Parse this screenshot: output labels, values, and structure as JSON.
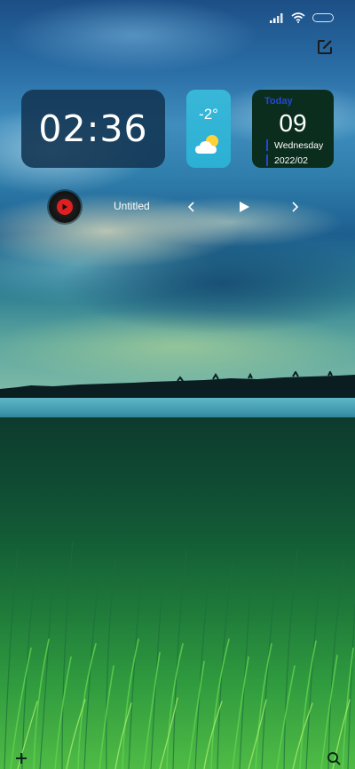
{
  "clock": {
    "time": "02:36"
  },
  "weather": {
    "temperature": "-2°",
    "icon": "partly-cloudy-icon"
  },
  "calendar": {
    "label": "Today",
    "day": "09",
    "weekday": "Wednesday",
    "year_month": "2022/02"
  },
  "music": {
    "title": "Untitled"
  },
  "status_bar": {
    "icons": [
      "signal-icon",
      "wifi-icon",
      "battery-icon"
    ]
  },
  "colors": {
    "clock_bg": "#123452",
    "weather_bg": "#2bb0d4",
    "calendar_bg": "#0b2d1e",
    "calendar_accent": "#2447d8",
    "music_red": "#e02020"
  }
}
